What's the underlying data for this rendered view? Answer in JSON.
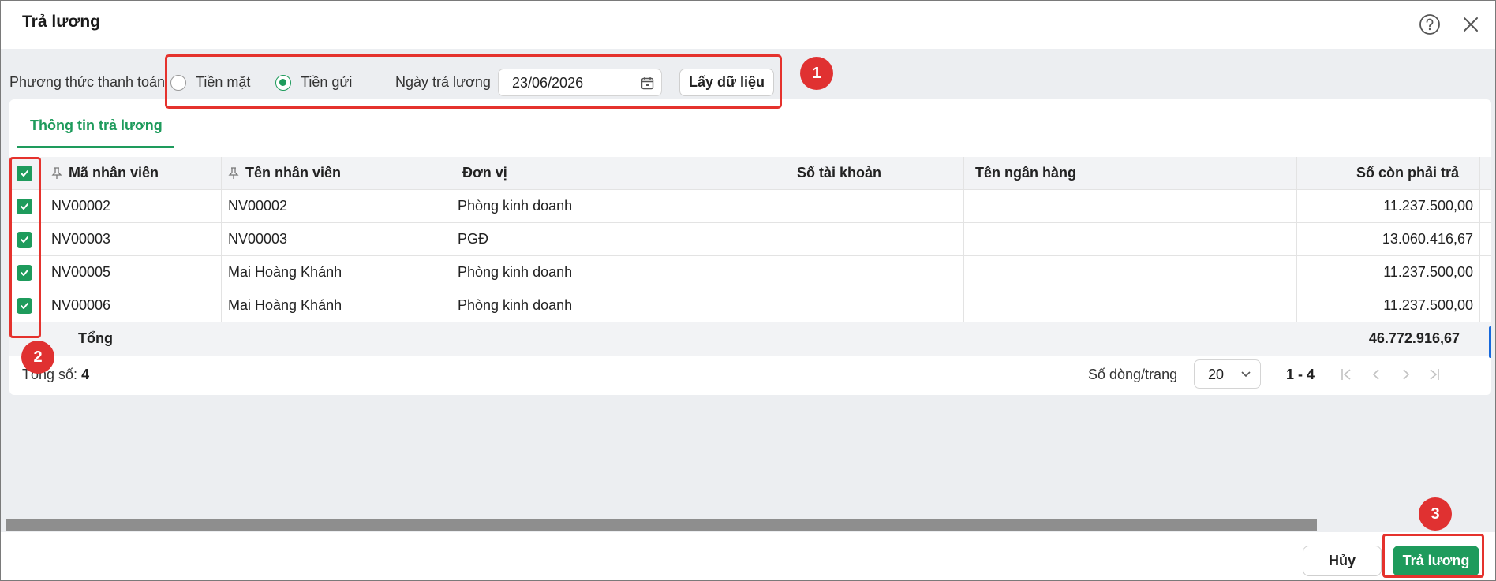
{
  "dialog": {
    "title": "Trả lương"
  },
  "payment": {
    "method_label": "Phương thức thanh toán",
    "options": [
      {
        "label": "Tiền mặt",
        "selected": false
      },
      {
        "label": "Tiền gửi",
        "selected": true
      }
    ],
    "date_label": "Ngày trả lương",
    "date_value": "23/06/2026",
    "fetch_label": "Lấy dữ liệu"
  },
  "tabs": [
    {
      "label": "Thông tin trả lương",
      "active": true
    }
  ],
  "table": {
    "columns": [
      "Mã nhân viên",
      "Tên nhân viên",
      "Đơn vị",
      "Số tài khoản",
      "Tên ngân hàng",
      "Số còn phải trả"
    ],
    "rows": [
      {
        "code": "NV00002",
        "name": "NV00002",
        "unit": "Phòng kinh doanh",
        "account": "",
        "bank": "",
        "amount": "11.237.500,00",
        "checked": true
      },
      {
        "code": "NV00003",
        "name": "NV00003",
        "unit": "PGĐ",
        "account": "",
        "bank": "",
        "amount": "13.060.416,67",
        "checked": true
      },
      {
        "code": "NV00005",
        "name": "Mai Hoàng Khánh",
        "unit": "Phòng kinh doanh",
        "account": "",
        "bank": "",
        "amount": "11.237.500,00",
        "checked": true
      },
      {
        "code": "NV00006",
        "name": "Mai Hoàng Khánh",
        "unit": "Phòng kinh doanh",
        "account": "",
        "bank": "",
        "amount": "11.237.500,00",
        "checked": true
      }
    ],
    "total_label": "Tổng",
    "total_amount": "46.772.916,67"
  },
  "footer": {
    "total_count_label": "Tổng số:",
    "total_count": "4",
    "rows_per_page_label": "Số dòng/trang",
    "rows_per_page": "20",
    "range": "1 - 4"
  },
  "actions": {
    "cancel": "Hủy",
    "submit": "Trả lương"
  },
  "annotations": [
    "1",
    "2",
    "3"
  ],
  "colors": {
    "accent": "#1e9b5c",
    "highlight": "#e5322d"
  }
}
